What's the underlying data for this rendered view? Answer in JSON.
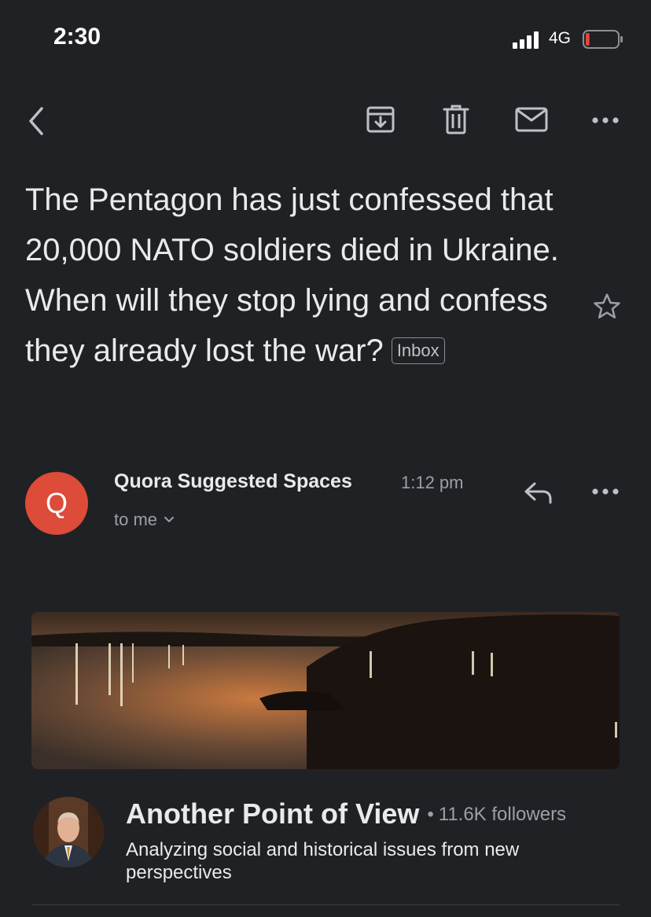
{
  "status_bar": {
    "time": "2:30",
    "network": "4G",
    "battery_level": 0.12,
    "battery_color": "#e5483a"
  },
  "toolbar": {
    "back_icon": "chevron-left-icon",
    "archive_icon": "archive-icon",
    "delete_icon": "trash-icon",
    "mark_unread_icon": "mail-icon",
    "more_icon": "more-horizontal-icon"
  },
  "email": {
    "subject": "The Pentagon has just confessed that 20,000 NATO soldiers died in Ukraine. When will they stop lying and confess they already lost the war?",
    "label": "Inbox",
    "starred": false,
    "sender": "Quora Suggested Spaces",
    "sender_initial": "Q",
    "avatar_color": "#dd4b39",
    "time": "1:12 pm",
    "recipient": "to me"
  },
  "space": {
    "title": "Another Point of View",
    "separator": "•",
    "followers": "11.6K followers",
    "description": "Analyzing social and historical issues from new perspectives"
  },
  "colors": {
    "background": "#202124",
    "text": "#e8eaed",
    "secondary": "#9aa0a6"
  }
}
